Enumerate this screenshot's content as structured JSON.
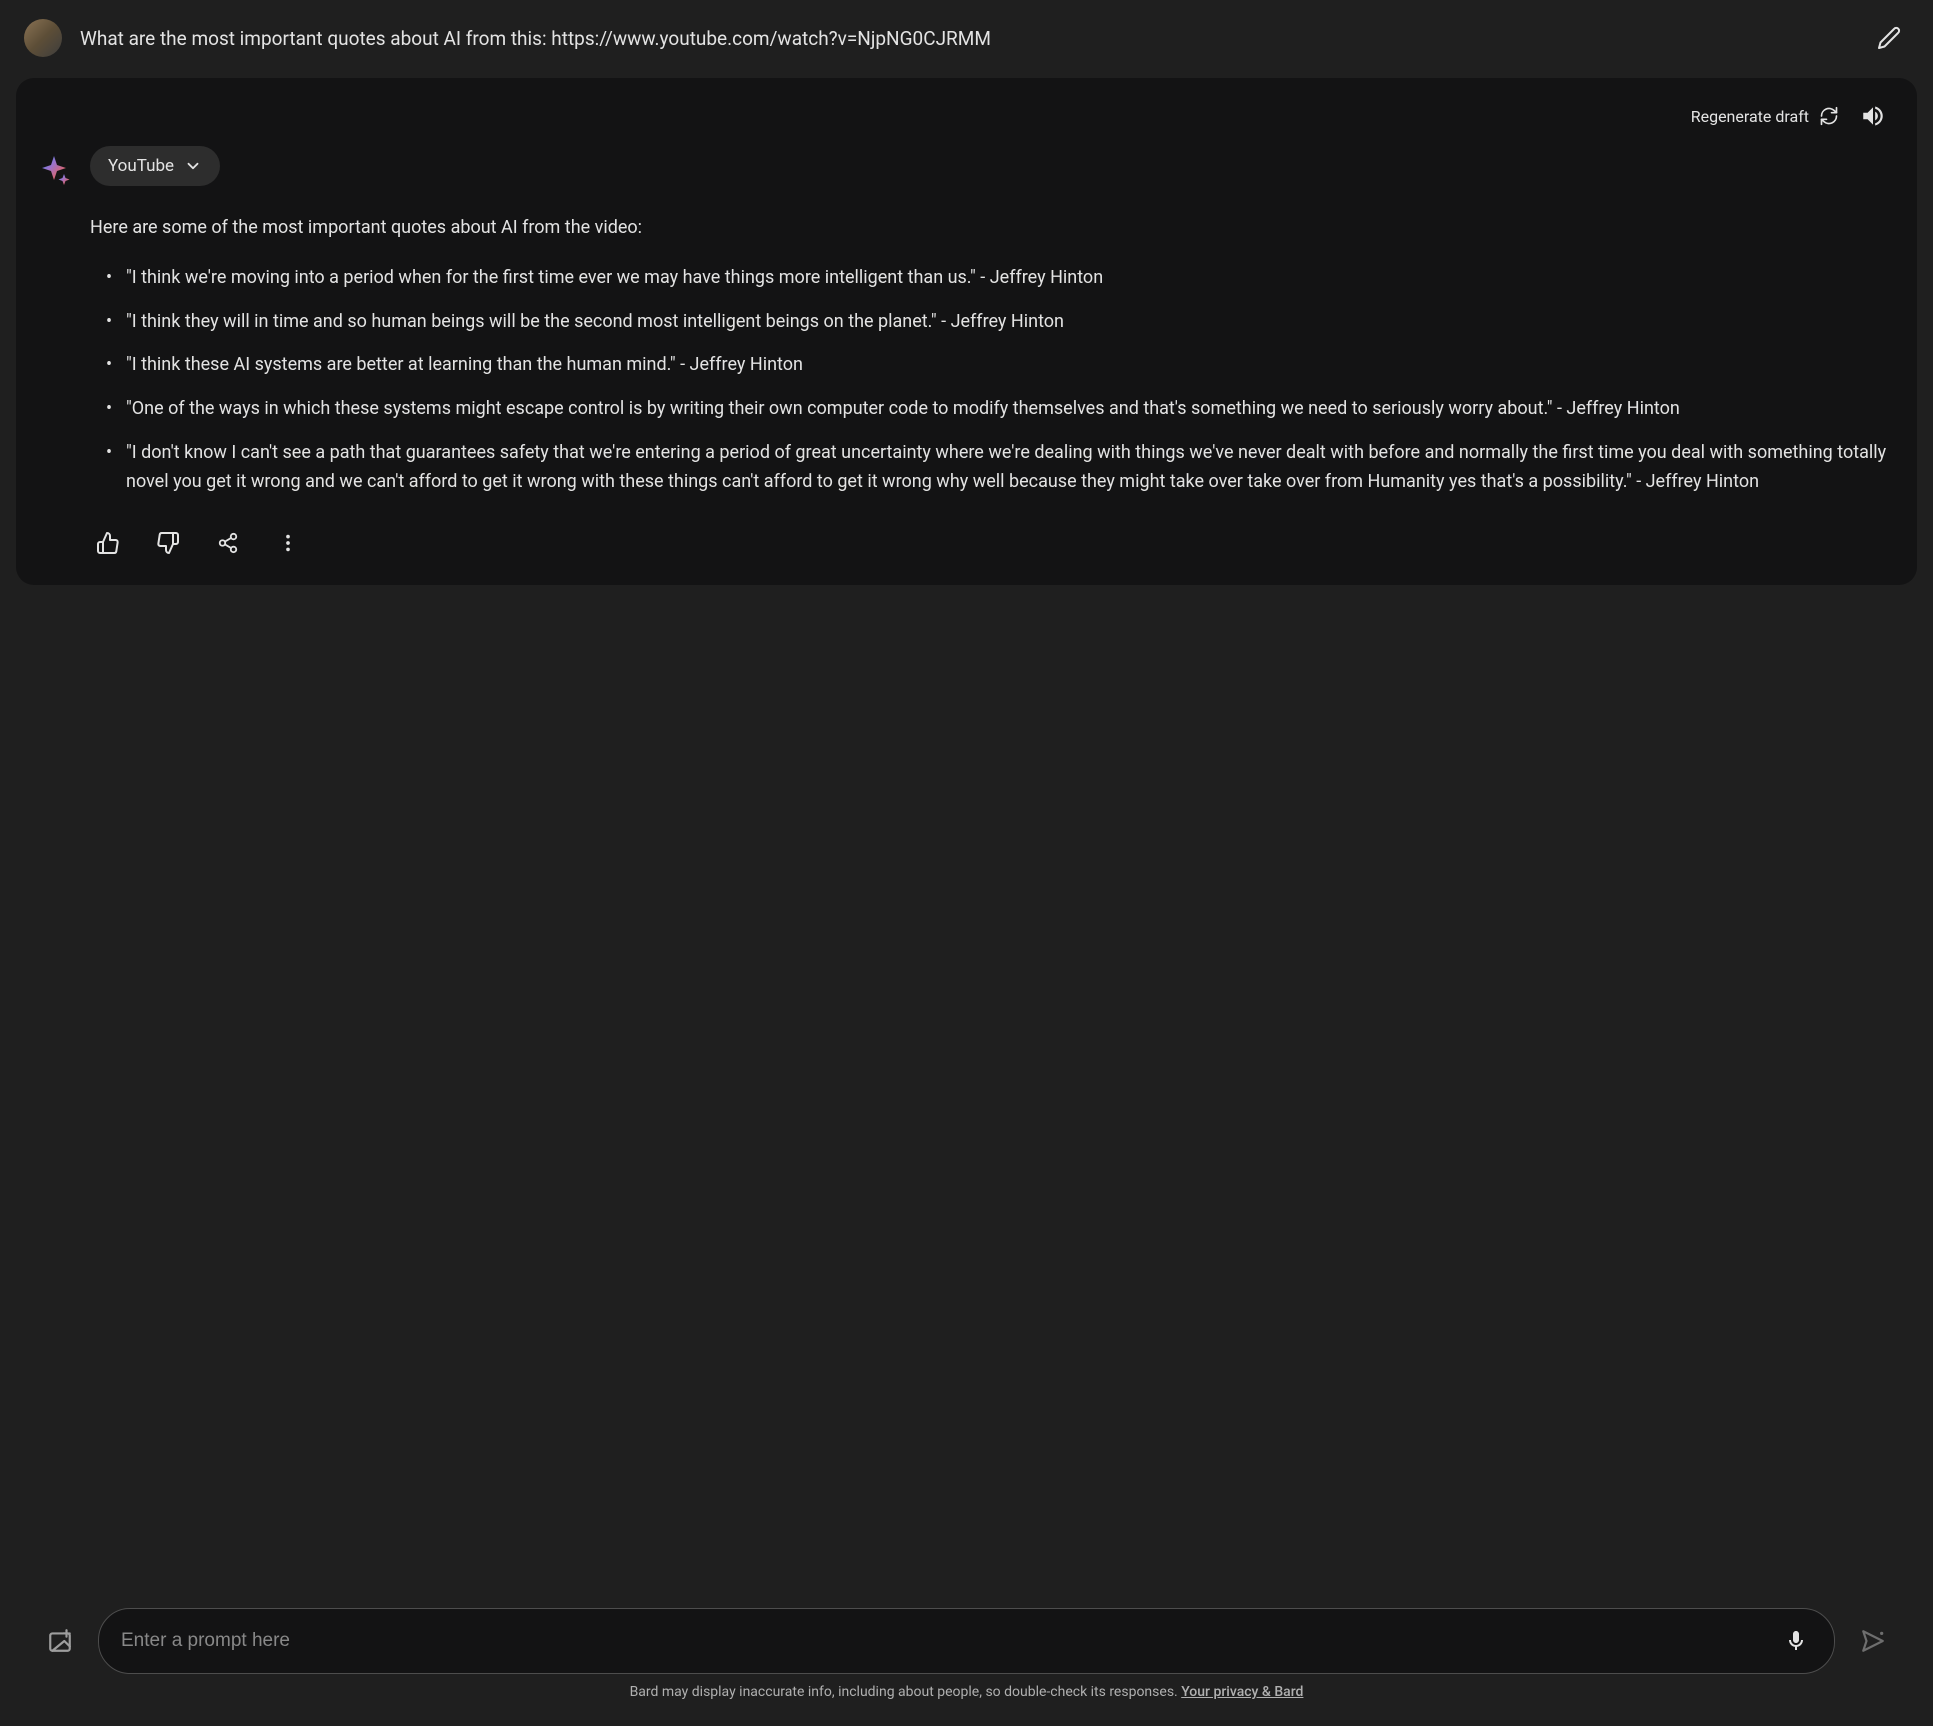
{
  "user_prompt": "What are the most important quotes about AI from this: https://www.youtube.com/watch?v=NjpNG0CJRMM",
  "response_header": {
    "regenerate_label": "Regenerate draft"
  },
  "chip": {
    "label": "YouTube"
  },
  "intro": "Here are some of the most important quotes about AI from the video:",
  "quotes": [
    "\"I think we're moving into a period when for the first time ever we may have things more intelligent than us.\" - Jeffrey Hinton",
    "\"I think they will in time and so human beings will be the second most intelligent beings on the planet.\" - Jeffrey Hinton",
    "\"I think these AI systems are better at learning than the human mind.\" - Jeffrey Hinton",
    "\"One of the ways in which these systems might escape control is by writing their own computer code to modify themselves and that's something we need to seriously worry about.\" - Jeffrey Hinton",
    "\"I don't know I can't see a path that guarantees safety that we're entering a period of great uncertainty where we're dealing with things we've never dealt with before and normally the first time you deal with something totally novel you get it wrong and we can't afford to get it wrong with these things can't afford to get it wrong why well because they might take over take over from Humanity yes that's a possibility.\" - Jeffrey Hinton"
  ],
  "input": {
    "placeholder": "Enter a prompt here"
  },
  "footer": {
    "note": "Bard may display inaccurate info, including about people, so double-check its responses. ",
    "link": "Your privacy & Bard"
  }
}
